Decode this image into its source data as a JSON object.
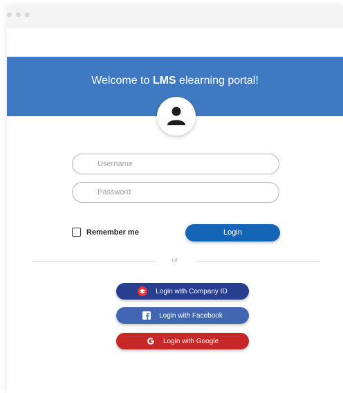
{
  "window": {
    "controls": [
      "dot",
      "dot",
      "dot"
    ]
  },
  "banner": {
    "title_prefix": "Welcome to ",
    "title_bold": "LMS",
    "title_suffix": " elearning portal!",
    "color": "#3e79c1",
    "avatar_icon": "user-icon"
  },
  "form": {
    "username_placeholder": "Username",
    "username_value": "",
    "password_placeholder": "Password",
    "password_value": "",
    "remember_label": "Remember me",
    "remember_checked": false,
    "login_label": "Login",
    "login_color": "#1565b7"
  },
  "divider": {
    "or_text": "or"
  },
  "social": {
    "company": {
      "label": "Login with Company ID",
      "color": "#283e8e",
      "icon": "graduation-cap-icon"
    },
    "facebook": {
      "label": "Login with Facebook",
      "color": "#4267b2",
      "icon": "facebook-icon"
    },
    "google": {
      "label": "Login with Google",
      "color": "#c62828",
      "icon": "google-icon"
    }
  }
}
